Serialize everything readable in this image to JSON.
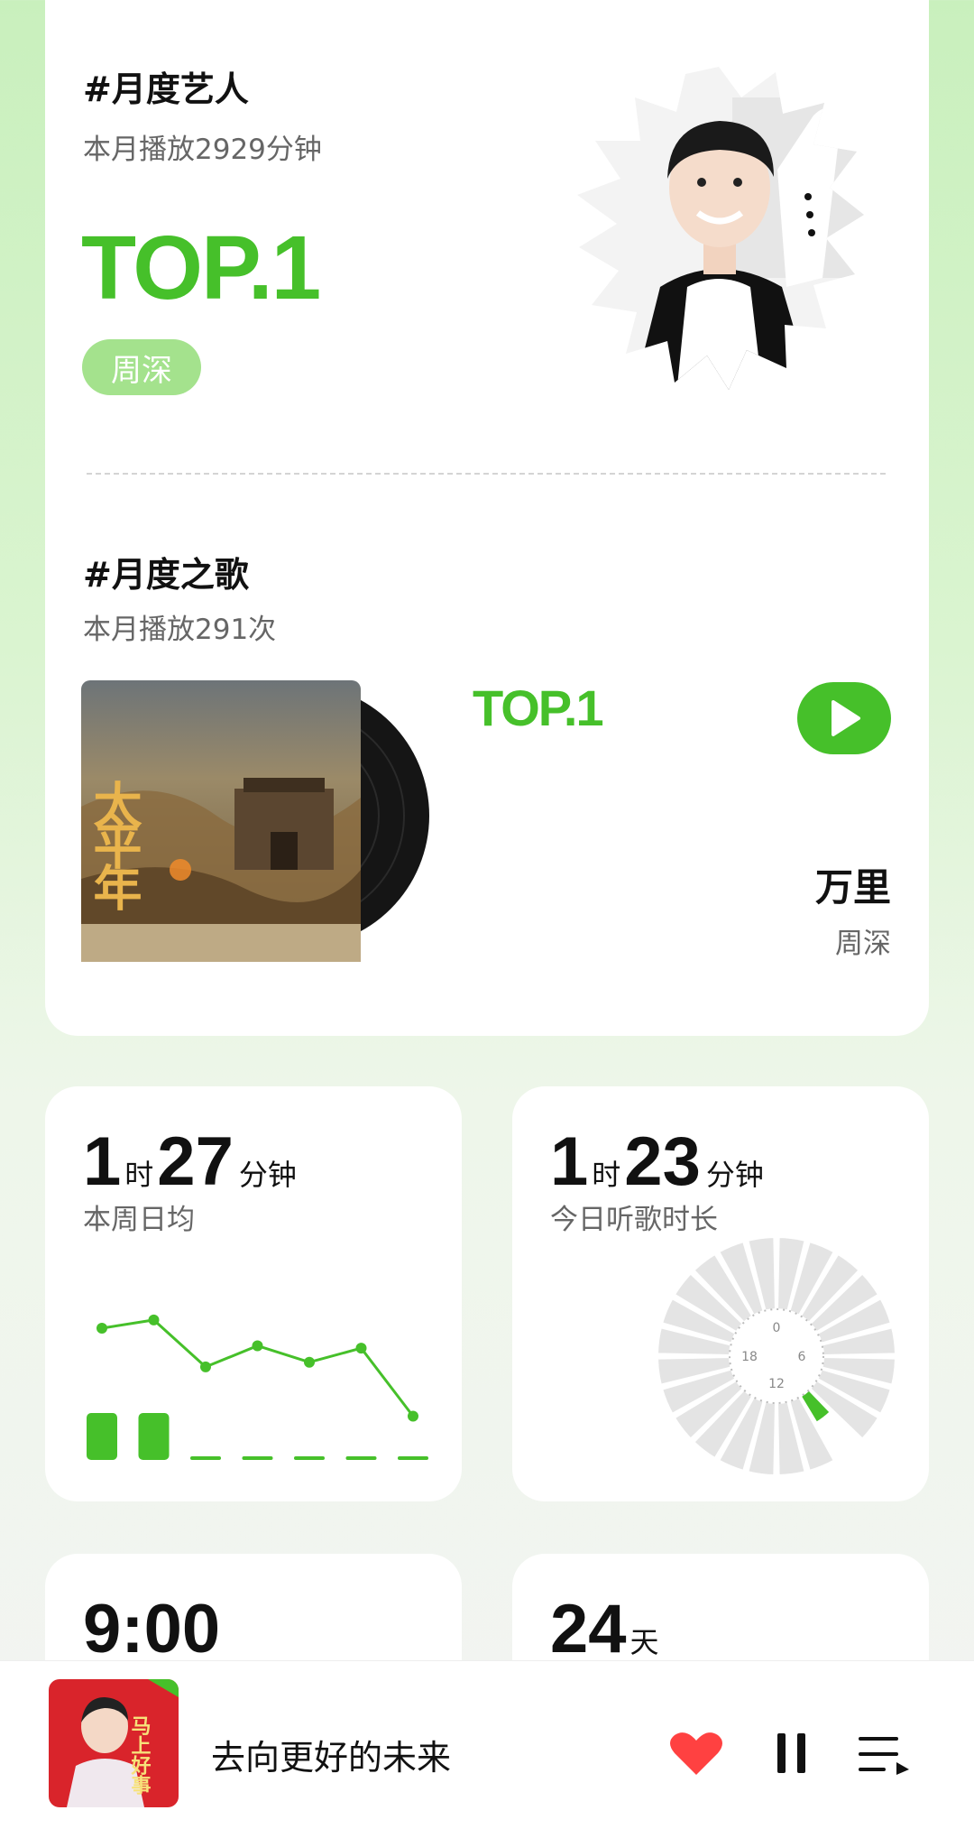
{
  "monthly_artist": {
    "title": "#月度艺人",
    "subtitle": "本月播放2929分钟",
    "rank": "TOP.1",
    "name": "周深"
  },
  "monthly_song": {
    "title": "#月度之歌",
    "subtitle": "本月播放291次",
    "rank": "TOP.1",
    "song": "万里",
    "artist": "周深",
    "album_cover_text": "太平年"
  },
  "weekly_avg": {
    "hours": "1",
    "hour_unit": "时",
    "minutes": "27",
    "minute_unit": "分钟",
    "label": "本周日均"
  },
  "today_listen": {
    "hours": "1",
    "hour_unit": "时",
    "minutes": "23",
    "minute_unit": "分钟",
    "label": "今日听歌时长",
    "clock_labels": [
      "0",
      "6",
      "12",
      "18"
    ]
  },
  "peak_time": {
    "value": "9:00"
  },
  "days": {
    "value": "24",
    "unit": "天"
  },
  "player": {
    "title": "去向更好的未来",
    "cover_text": "马上好事"
  },
  "chart_data": {
    "type": "line",
    "line_values": [
      4.0,
      4.7,
      0.7,
      2.5,
      1.1,
      2.3,
      -3.5
    ],
    "bar_values": [
      1,
      1,
      0,
      0,
      0,
      0,
      0
    ],
    "colors": {
      "accent": "#46c02a"
    }
  },
  "colors": {
    "accent": "#46c02a",
    "heart": "#ff4141"
  }
}
